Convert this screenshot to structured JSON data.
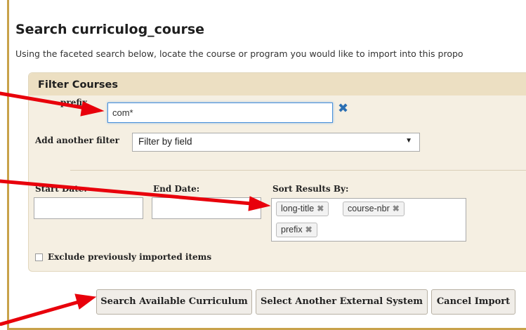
{
  "page": {
    "title": "Search curriculog_course",
    "subtitle": "Using the faceted search below, locate the course or program you would like to import into this propo"
  },
  "filter_panel": {
    "title": "Filter Courses",
    "prefix_label": "prefix",
    "prefix_value": "com*",
    "add_filter_label": "Add another filter",
    "add_filter_select": "Filter by field",
    "start_date_label": "Start Date:",
    "start_date_value": "",
    "end_date_label": "End Date:",
    "end_date_value": "",
    "sort_label": "Sort Results By:",
    "sort_tags": [
      "long-title",
      "course-nbr",
      "prefix"
    ],
    "exclude_label": "Exclude previously imported items",
    "exclude_checked": false
  },
  "buttons": {
    "search": "Search Available Curriculum",
    "select_system": "Select Another External System",
    "cancel": "Cancel Import"
  },
  "colors": {
    "annotation_arrow": "#e8000b",
    "panel_bg": "#f5efe2",
    "frame_border": "#c8a24a"
  }
}
